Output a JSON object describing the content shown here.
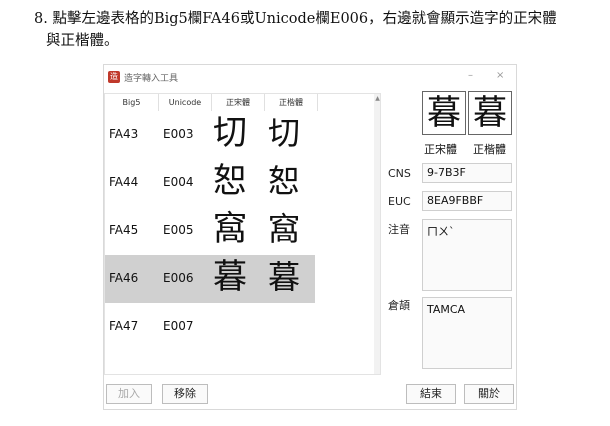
{
  "instruction": {
    "line1": "8. 點擊左邊表格的Big5欄FA46或Unicode欄E006，右邊就會顯示造字的正宋體",
    "line2": "與正楷體。"
  },
  "window": {
    "title": "造字轉入工具",
    "app_icon_glyph": "造",
    "minimize_glyph": "–",
    "close_glyph": "×"
  },
  "table": {
    "headers": [
      "Big5",
      "Unicode",
      "正宋體",
      "正楷體"
    ],
    "rows": [
      {
        "big5": "FA43",
        "unicode": "E003",
        "song": "切",
        "kai": "切"
      },
      {
        "big5": "FA44",
        "unicode": "E004",
        "song": "恕",
        "kai": "恕"
      },
      {
        "big5": "FA45",
        "unicode": "E005",
        "song": "窩",
        "kai": "窩"
      },
      {
        "big5": "FA46",
        "unicode": "E006",
        "song": "暮",
        "kai": "暮"
      },
      {
        "big5": "FA47",
        "unicode": "E007",
        "song": "",
        "kai": ""
      }
    ],
    "selected_row": 3,
    "scroll_up_glyph": "▲"
  },
  "preview": {
    "song_glyph": "暮",
    "kai_glyph": "暮",
    "song_label": "正宋體",
    "kai_label": "正楷體"
  },
  "fields": {
    "cns_label": "CNS",
    "cns_value": "9-7B3F",
    "euc_label": "EUC",
    "euc_value": "8EA9FBBF",
    "zhuyin_label": "注音",
    "zhuyin_value": "ㄇㄨˋ",
    "cangjie_label": "倉頡",
    "cangjie_value": "TAMCA"
  },
  "buttons": {
    "add": "加入",
    "remove": "移除",
    "end": "結束",
    "about": "關於"
  }
}
